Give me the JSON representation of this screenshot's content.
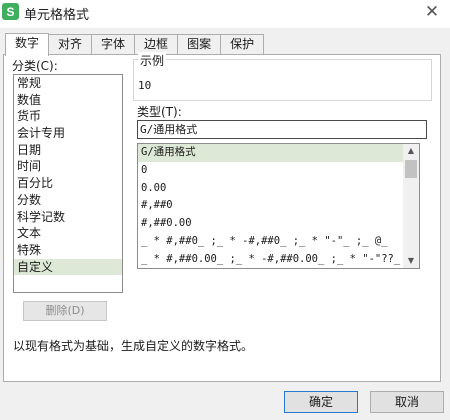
{
  "window": {
    "title": "单元格格式",
    "app_icon_glyph": "S",
    "close_glyph": "✕"
  },
  "tabs": [
    {
      "label": "数字",
      "active": true
    },
    {
      "label": "对齐"
    },
    {
      "label": "字体"
    },
    {
      "label": "边框"
    },
    {
      "label": "图案"
    },
    {
      "label": "保护"
    }
  ],
  "category": {
    "label": "分类(C):",
    "items": [
      "常规",
      "数值",
      "货币",
      "会计专用",
      "日期",
      "时间",
      "百分比",
      "分数",
      "科学记数",
      "文本",
      "特殊",
      "自定义"
    ],
    "selected_index": 11
  },
  "delete_button": {
    "label": "删除(D)",
    "enabled": false
  },
  "sample": {
    "label": "示例",
    "value": "10"
  },
  "type": {
    "label": "类型(T):",
    "value": "G/通用格式",
    "options": [
      "G/通用格式",
      "0",
      "0.00",
      "#,##0",
      "#,##0.00",
      "_ * #,##0_ ;_ * -#,##0_ ;_ * \"-\"_ ;_ @_",
      "_ * #,##0.00_ ;_ * -#,##0.00_ ;_ * \"-\"??_"
    ],
    "selected_index": 0
  },
  "description": "以现有格式为基础，生成自定义的数字格式。",
  "buttons": {
    "ok": "确定",
    "cancel": "取消"
  },
  "icons": {
    "scroll_up": "▲",
    "scroll_down": "▼"
  },
  "colors": {
    "selection": "#dde8d6",
    "app_icon": "#3fae5e",
    "ok_border": "#2b78d1"
  }
}
